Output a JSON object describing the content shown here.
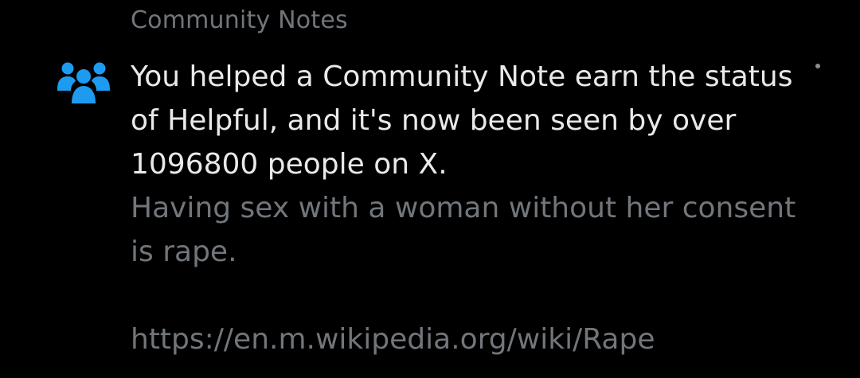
{
  "notification": {
    "header": "Community Notes",
    "icon": "community-notes-people-icon",
    "message": "You helped a Community Note earn the status\nof Helpful, and it's now been seen by over\n1096800 people on X.",
    "note_text": "Having sex with a woman without her consent\nis rape.",
    "note_link": "https://en.m.wikipedia.org/wiki/Rape"
  },
  "colors": {
    "background": "#000000",
    "primary_text": "#e7e9ea",
    "secondary_text": "#71767b",
    "icon": "#1d9bf0"
  }
}
